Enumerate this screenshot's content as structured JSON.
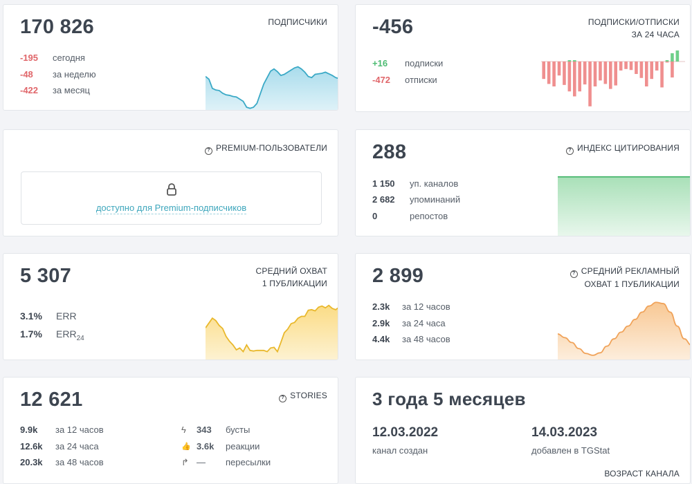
{
  "subscribers": {
    "title": "ПОДПИСЧИКИ",
    "value": "170 826",
    "rows": [
      {
        "value": "-195",
        "label": "сегодня"
      },
      {
        "value": "-48",
        "label": "за неделю"
      },
      {
        "value": "-422",
        "label": "за месяц"
      }
    ],
    "sparkline": [
      0.62,
      0.57,
      0.4,
      0.37,
      0.36,
      0.31,
      0.28,
      0.27,
      0.25,
      0.24,
      0.2,
      0.16,
      0.05,
      0.03,
      0.05,
      0.12,
      0.3,
      0.48,
      0.6,
      0.72,
      0.76,
      0.71,
      0.64,
      0.66,
      0.7,
      0.74,
      0.78,
      0.8,
      0.76,
      0.7,
      0.62,
      0.6,
      0.66,
      0.67,
      0.68,
      0.7,
      0.67,
      0.64,
      0.6,
      0.58
    ]
  },
  "subs_unsubs": {
    "title_line1": "ПОДПИСКИ/ОТПИСКИ",
    "title_line2": "ЗА 24 ЧАСА",
    "value": "-456",
    "rows": [
      {
        "value": "+16",
        "label": "подписки"
      },
      {
        "value": "-472",
        "label": "отписки"
      }
    ],
    "bars": [
      {
        "pos": 0,
        "neg": 35
      },
      {
        "pos": 0,
        "neg": 45
      },
      {
        "pos": 0,
        "neg": 50
      },
      {
        "pos": 0,
        "neg": 28
      },
      {
        "pos": 0,
        "neg": 47
      },
      {
        "pos": 2,
        "neg": 60
      },
      {
        "pos": 2,
        "neg": 70
      },
      {
        "pos": 0,
        "neg": 60
      },
      {
        "pos": 0,
        "neg": 46
      },
      {
        "pos": 0,
        "neg": 90
      },
      {
        "pos": 0,
        "neg": 50
      },
      {
        "pos": 0,
        "neg": 38
      },
      {
        "pos": 0,
        "neg": 45
      },
      {
        "pos": 0,
        "neg": 55
      },
      {
        "pos": 0,
        "neg": 48
      },
      {
        "pos": 0,
        "neg": 18
      },
      {
        "pos": 0,
        "neg": 15
      },
      {
        "pos": 0,
        "neg": 17
      },
      {
        "pos": 0,
        "neg": 25
      },
      {
        "pos": 0,
        "neg": 33
      },
      {
        "pos": 0,
        "neg": 50
      },
      {
        "pos": 0,
        "neg": 35
      },
      {
        "pos": 0,
        "neg": 18
      },
      {
        "pos": 0,
        "neg": 52
      },
      {
        "pos": 2,
        "neg": 2
      },
      {
        "pos": 12,
        "neg": 32
      },
      {
        "pos": 16,
        "neg": 0
      },
      {
        "pos": 0,
        "neg": 0
      }
    ],
    "colors": {
      "pos": "#6fd08a",
      "neg": "#ef8f8f"
    }
  },
  "premium": {
    "title": "PREMIUM-ПОЛЬЗОВАТЕЛИ",
    "icon": "question-icon",
    "lock_icon": "lock-icon",
    "link_text": "доступно для Premium-подписчиков"
  },
  "citation": {
    "title": "ИНДЕКС ЦИТИРОВАНИЯ",
    "icon": "question-icon",
    "value": "288",
    "rows": [
      {
        "value": "1 150",
        "label": "уп. каналов"
      },
      {
        "value": "2 682",
        "label": "упоминаний"
      },
      {
        "value": "0",
        "label": "репостов"
      }
    ],
    "color": "#45b56b"
  },
  "reach": {
    "title_line1": "СРЕДНИЙ ОХВАТ",
    "title_line2": "1 ПУБЛИКАЦИИ",
    "value": "5 307",
    "rows": [
      {
        "value": "3.1%",
        "label": "ERR",
        "sub": ""
      },
      {
        "value": "1.7%",
        "label": "ERR",
        "sub": "24"
      }
    ],
    "sparkline": [
      0.52,
      0.6,
      0.68,
      0.64,
      0.56,
      0.51,
      0.38,
      0.3,
      0.24,
      0.16,
      0.19,
      0.13,
      0.24,
      0.15,
      0.14,
      0.15,
      0.15,
      0.15,
      0.13,
      0.19,
      0.2,
      0.13,
      0.28,
      0.44,
      0.5,
      0.59,
      0.61,
      0.68,
      0.71,
      0.71,
      0.81,
      0.82,
      0.8,
      0.86,
      0.88,
      0.85,
      0.89,
      0.84,
      0.82,
      0.86
    ],
    "color": "#e9b82c"
  },
  "ad_reach": {
    "title_line1": "СРЕДНИЙ РЕКЛАМНЫЙ",
    "title_line2": "ОХВАТ 1 ПУБЛИКАЦИИ",
    "icon": "question-icon",
    "value": "2 899",
    "rows": [
      {
        "value": "2.3k",
        "label": "за 12 часов"
      },
      {
        "value": "2.9k",
        "label": "за 24 часа"
      },
      {
        "value": "4.4k",
        "label": "за 48 часов"
      }
    ],
    "sparkline": [
      0.42,
      0.36,
      0.28,
      0.18,
      0.1,
      0.07,
      0.11,
      0.22,
      0.34,
      0.45,
      0.55,
      0.66,
      0.78,
      0.88,
      0.94,
      0.92,
      0.78,
      0.55,
      0.34,
      0.24
    ],
    "color": "#f0a35a"
  },
  "stories": {
    "title": "STORIES",
    "icon": "question-icon",
    "value": "12 621",
    "rows": [
      {
        "value": "9.9k",
        "label": "за 12 часов"
      },
      {
        "value": "12.6k",
        "label": "за 24 часа"
      },
      {
        "value": "20.3k",
        "label": "за 48 часов"
      }
    ],
    "right_rows": [
      {
        "icon": "lightning-icon",
        "glyph": "ϟ",
        "value": "343",
        "label": "бусты"
      },
      {
        "icon": "thumbs-up-icon",
        "glyph": "👍",
        "value": "3.6k",
        "label": "реакции"
      },
      {
        "icon": "forward-arrow-icon",
        "glyph": "↱",
        "value": "—",
        "label": "пересылки"
      }
    ]
  },
  "age": {
    "value": "3 года 5 месяцев",
    "created_date": "12.03.2022",
    "created_label": "канал создан",
    "added_date": "14.03.2023",
    "added_label": "добавлен в TGStat",
    "footer": "ВОЗРАСТ КАНАЛА"
  }
}
